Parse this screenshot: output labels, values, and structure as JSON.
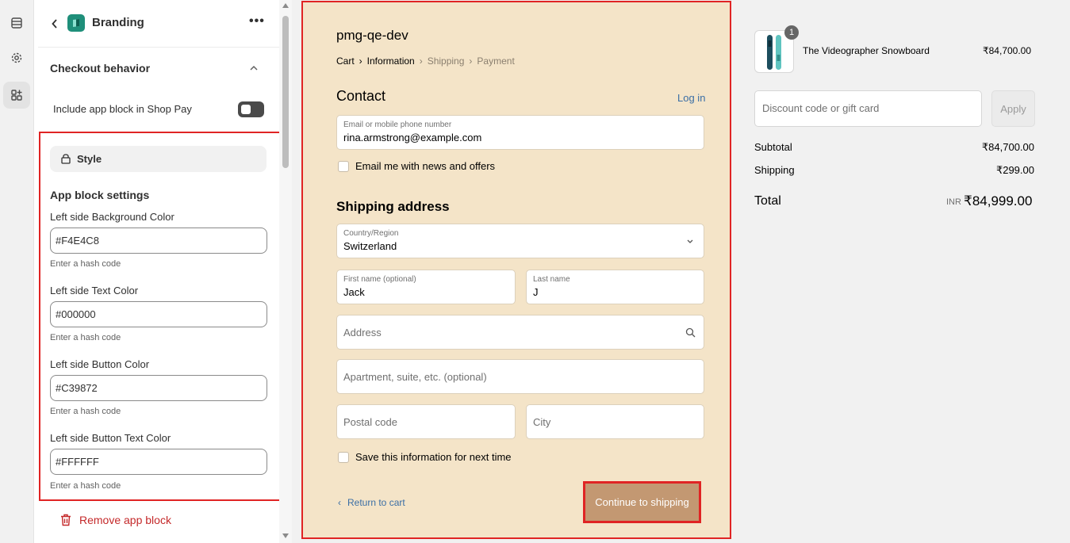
{
  "editor": {
    "title": "Branding",
    "more_label": "•••",
    "section_title": "Checkout behavior",
    "toggle_label": "Include app block in Shop Pay",
    "style_tab_label": "Style",
    "app_block_settings_title": "App block settings",
    "fields": [
      {
        "label": "Left side Background Color",
        "value": "#F4E4C8",
        "help": "Enter a hash code"
      },
      {
        "label": "Left side Text Color",
        "value": "#000000",
        "help": "Enter a hash code"
      },
      {
        "label": "Left side Button Color",
        "value": "#C39872",
        "help": "Enter a hash code"
      },
      {
        "label": "Left side Button Text Color",
        "value": "#FFFFFF",
        "help": "Enter a hash code"
      }
    ],
    "remove_label": "Remove app block"
  },
  "checkout": {
    "shop_name": "pmg-qe-dev",
    "breadcrumbs": [
      "Cart",
      "Information",
      "Shipping",
      "Payment"
    ],
    "contact_heading": "Contact",
    "login_label": "Log in",
    "email_label": "Email or mobile phone number",
    "email_value": "rina.armstrong@example.com",
    "news_label": "Email me with news and offers",
    "shipping_heading": "Shipping address",
    "country_label": "Country/Region",
    "country_value": "Switzerland",
    "first_name_label": "First name (optional)",
    "first_name_value": "Jack",
    "last_name_label": "Last name",
    "last_name_value": "J",
    "address_placeholder": "Address",
    "apartment_placeholder": "Apartment, suite, etc. (optional)",
    "postal_placeholder": "Postal code",
    "city_placeholder": "City",
    "save_label": "Save this information for next time",
    "return_label": "Return to cart",
    "continue_label": "Continue to shipping"
  },
  "summary": {
    "qty": "1",
    "product_name": "The Videographer Snowboard",
    "product_price": "₹84,700.00",
    "discount_placeholder": "Discount code or gift card",
    "apply_label": "Apply",
    "subtotal_label": "Subtotal",
    "subtotal_value": "₹84,700.00",
    "shipping_label": "Shipping",
    "shipping_value": "₹299.00",
    "total_label": "Total",
    "total_currency": "INR",
    "total_value": "₹84,999.00"
  },
  "colors": {
    "left_bg": "#F4E4C8",
    "button": "#C39872",
    "highlight": "#E02424"
  }
}
